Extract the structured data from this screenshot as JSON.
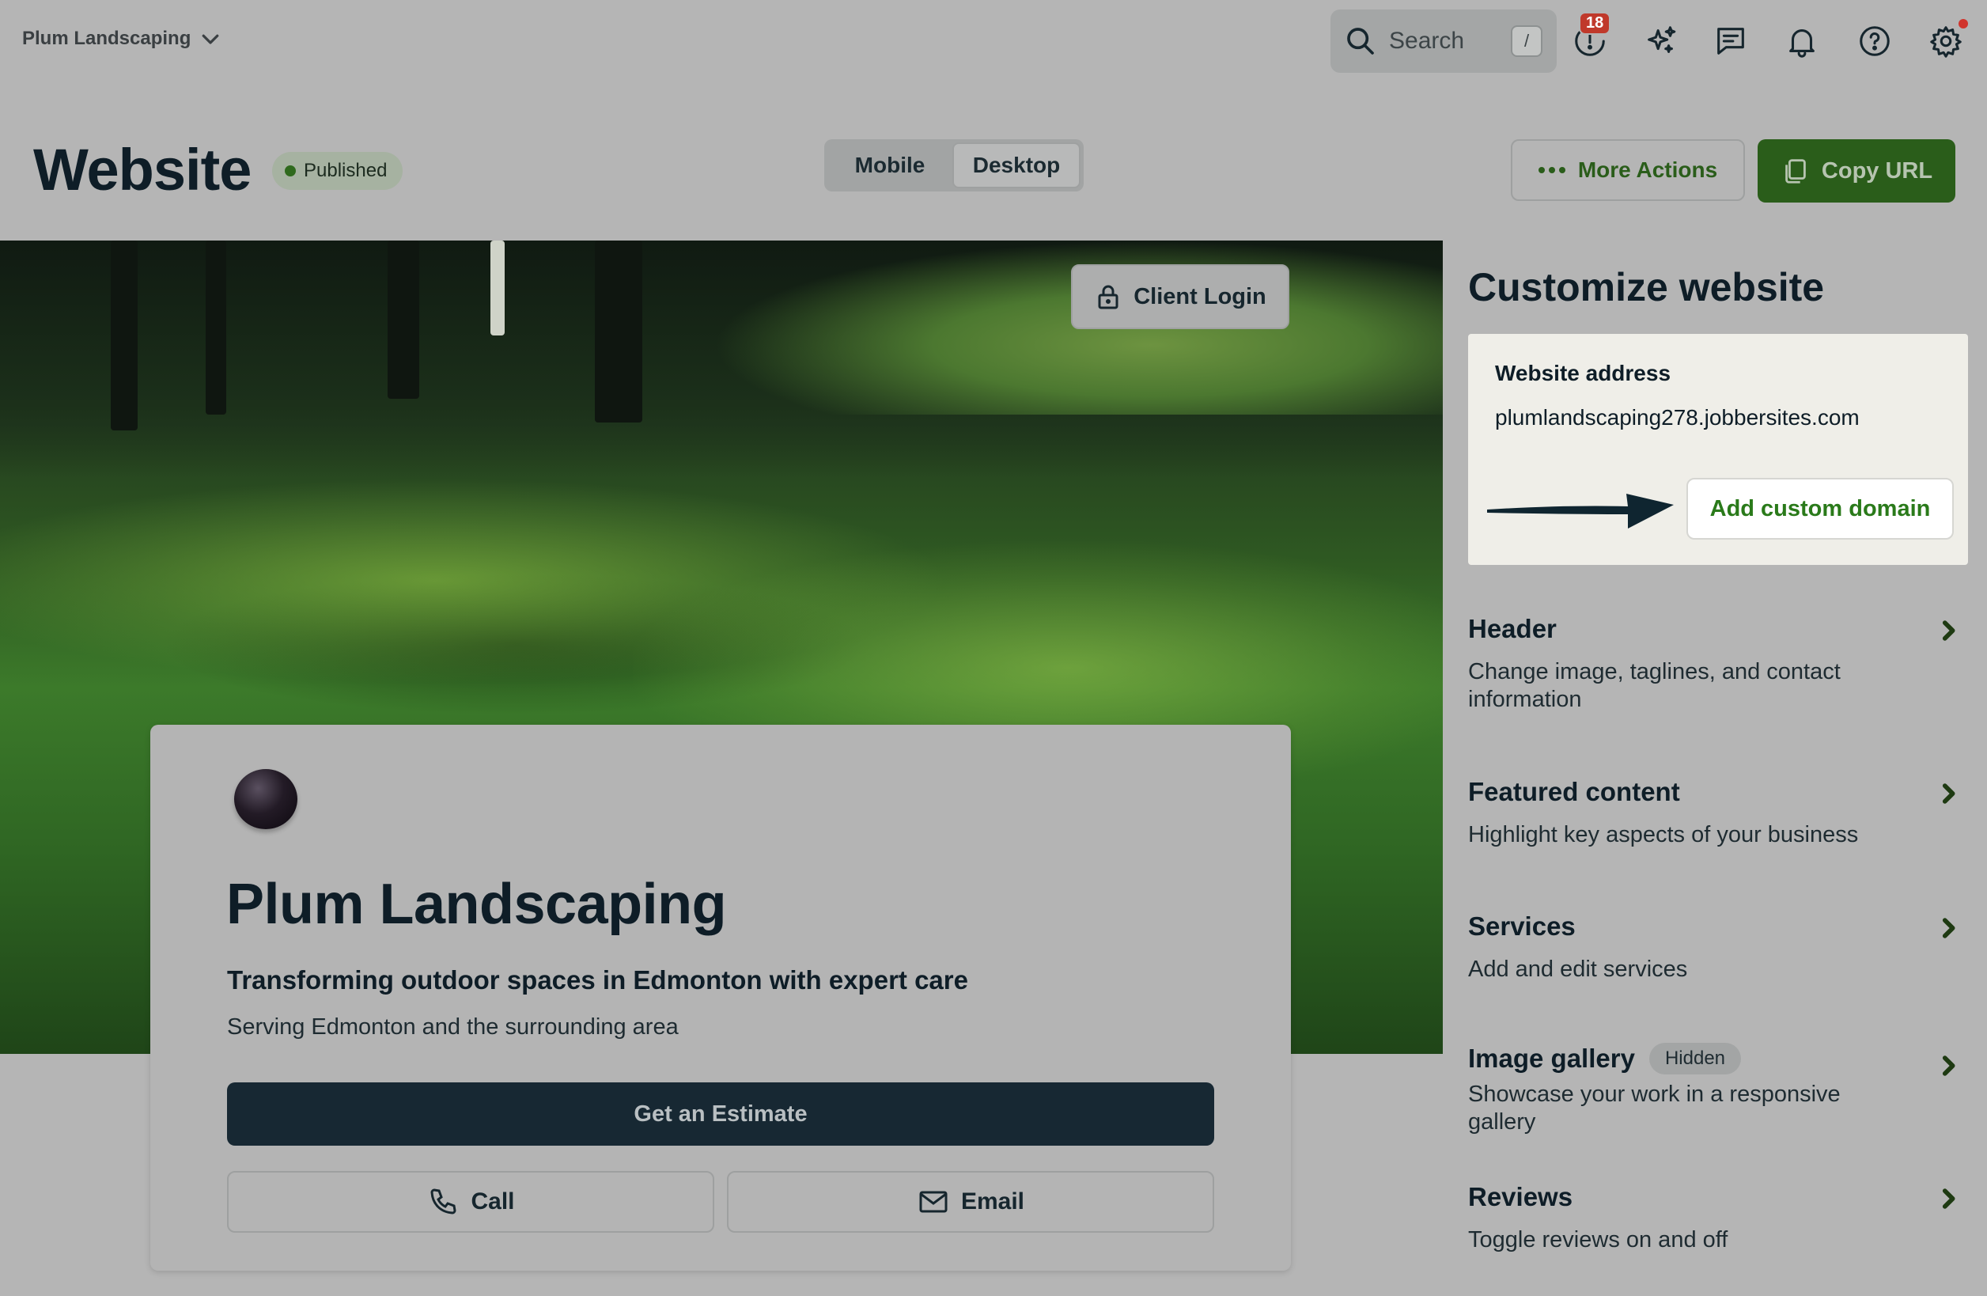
{
  "topbar": {
    "company": "Plum Landscaping",
    "search_placeholder": "Search",
    "search_shortcut": "/",
    "notifications_badge": "18",
    "icons": [
      "clock-alert-icon",
      "sparkles-icon",
      "chat-icon",
      "bell-icon",
      "help-icon",
      "gear-icon"
    ]
  },
  "page": {
    "title": "Website",
    "status": "Published",
    "view_options": [
      "Mobile",
      "Desktop"
    ],
    "selected_view": "Desktop",
    "more_actions_label": "More Actions",
    "copy_url_label": "Copy URL"
  },
  "preview": {
    "client_login_label": "Client Login",
    "business_name": "Plum Landscaping",
    "tagline": "Transforming outdoor spaces in Edmonton with expert care",
    "service_area": "Serving Edmonton and the surrounding area",
    "estimate_label": "Get an Estimate",
    "call_label": "Call",
    "email_label": "Email"
  },
  "panel": {
    "title": "Customize website",
    "address_label": "Website address",
    "address_value": "plumlandscaping278.jobbersites.com",
    "custom_domain_label": "Add custom domain",
    "sections": [
      {
        "title": "Header",
        "description": "Change image, taglines, and contact information"
      },
      {
        "title": "Featured content",
        "description": "Highlight key aspects of your business"
      },
      {
        "title": "Services",
        "description": "Add and edit services"
      },
      {
        "title": "Image gallery",
        "badge": "Hidden",
        "description": "Showcase your work in a responsive gallery"
      },
      {
        "title": "Reviews",
        "description": "Toggle reviews on and off"
      }
    ]
  },
  "colors": {
    "brand_green": "#2a5d1a",
    "dark_navy": "#172833",
    "link_green": "#2a7a1a"
  }
}
